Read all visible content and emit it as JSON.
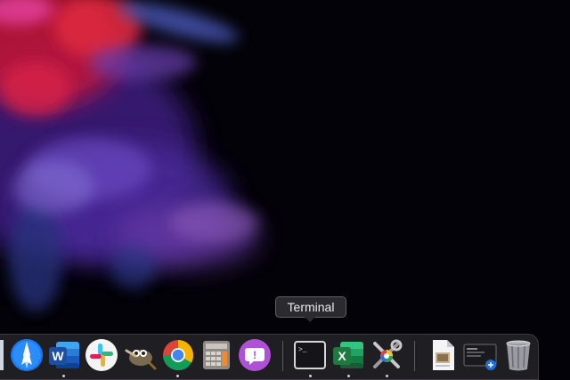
{
  "desktop": {
    "tooltip": {
      "text": "Terminal"
    }
  },
  "dock": {
    "apps": [
      {
        "name": "finder-partial",
        "icon": "finder-icon",
        "running": false
      },
      {
        "name": "safari",
        "icon": "safari-compass-icon",
        "running": false
      },
      {
        "name": "word",
        "icon": "word-icon",
        "letter": "W",
        "running": true
      },
      {
        "name": "slack",
        "icon": "slack-icon",
        "running": false
      },
      {
        "name": "gimp",
        "icon": "gimp-icon",
        "running": false
      },
      {
        "name": "chrome",
        "icon": "chrome-icon",
        "running": true
      },
      {
        "name": "calculator",
        "icon": "calculator-icon",
        "running": false
      },
      {
        "name": "feedback",
        "icon": "feedback-exclamation-icon",
        "letter": "!",
        "running": false
      },
      {
        "name": "terminal",
        "icon": "terminal-icon",
        "prompt": ">_",
        "running": true
      },
      {
        "name": "excel",
        "icon": "excel-icon",
        "letter": "X",
        "running": true
      },
      {
        "name": "system-tools",
        "icon": "wrench-screwdriver-icon",
        "running": true
      },
      {
        "name": "preview-document",
        "icon": "document-icon",
        "running": false
      },
      {
        "name": "screen-share",
        "icon": "screen-window-icon",
        "running": false
      },
      {
        "name": "trash",
        "icon": "trash-icon",
        "running": false
      }
    ],
    "colors": {
      "accent_blue": "#1f6fd6",
      "word_blue": "#2b5fb8",
      "excel_green": "#1e7a3e",
      "feedback_purple": "#b04fd8"
    }
  }
}
